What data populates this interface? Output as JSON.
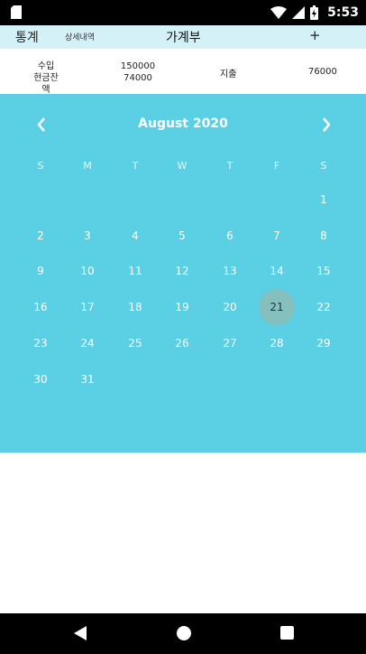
{
  "status_bar": {
    "time": "5:53",
    "icons": [
      "sd-card-icon",
      "wifi-icon",
      "cell-signal-icon",
      "battery-charging-icon"
    ]
  },
  "toolbar": {
    "stats_label": "통계",
    "details_label": "상세내역",
    "title": "가계부",
    "add_label": "+"
  },
  "summary": {
    "income_label": "수입",
    "cash_balance_label": "현금잔액",
    "income_value": "150000",
    "cash_balance_value": "74000",
    "expense_label": "지출",
    "expense_value": "76000"
  },
  "calendar": {
    "month_label": "August 2020",
    "weekdays": [
      "S",
      "M",
      "T",
      "W",
      "T",
      "F",
      "S"
    ],
    "first_weekday_index": 6,
    "days_in_month": 31,
    "selected_day": 21,
    "background_color": "#5bcfe3",
    "selected_color": "#85c0bf"
  },
  "nav_bar": {
    "buttons": [
      "back-icon",
      "home-icon",
      "recents-icon"
    ]
  }
}
